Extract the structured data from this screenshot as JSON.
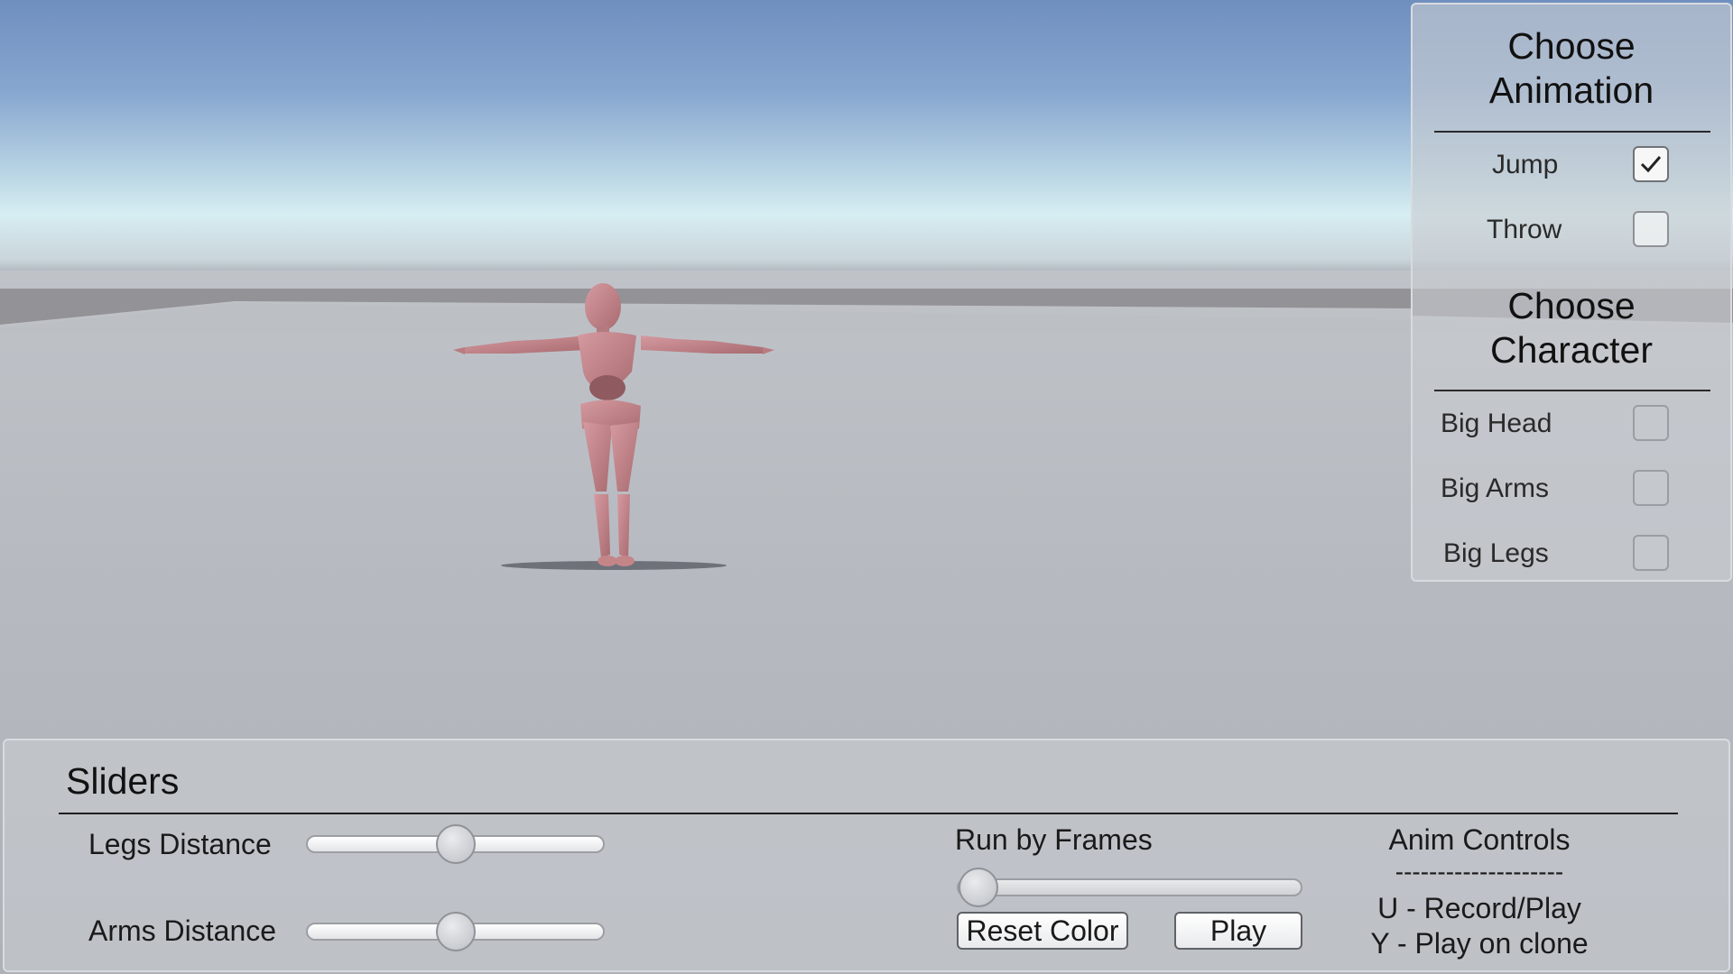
{
  "animation_panel": {
    "title_line1": "Choose",
    "title_line2": "Animation",
    "options": [
      {
        "label": "Jump",
        "checked": true
      },
      {
        "label": "Throw",
        "checked": false
      }
    ]
  },
  "character_panel": {
    "title_line1": "Choose",
    "title_line2": "Character",
    "options": [
      {
        "label": "Big Head",
        "checked": false
      },
      {
        "label": "Big Arms",
        "checked": false
      },
      {
        "label": "Big Legs",
        "checked": false
      }
    ]
  },
  "sliders_panel": {
    "title": "Sliders",
    "legs_distance": {
      "label": "Legs Distance",
      "value": 0.5
    },
    "arms_distance": {
      "label": "Arms Distance",
      "value": 0.5
    },
    "run_by_frames": {
      "label": "Run by Frames",
      "value": 0.0
    },
    "reset_color_label": "Reset Color",
    "play_label": "Play"
  },
  "anim_controls": {
    "title": "Anim Controls",
    "separator": "--------------------",
    "line1": "U - Record/Play",
    "line2": "Y - Play on clone"
  },
  "colors": {
    "character": "#c98a8e",
    "sky_top": "#6f8fbf",
    "ground": "#b7bbc1"
  },
  "icons": {
    "checkmark": "checkmark-icon"
  }
}
